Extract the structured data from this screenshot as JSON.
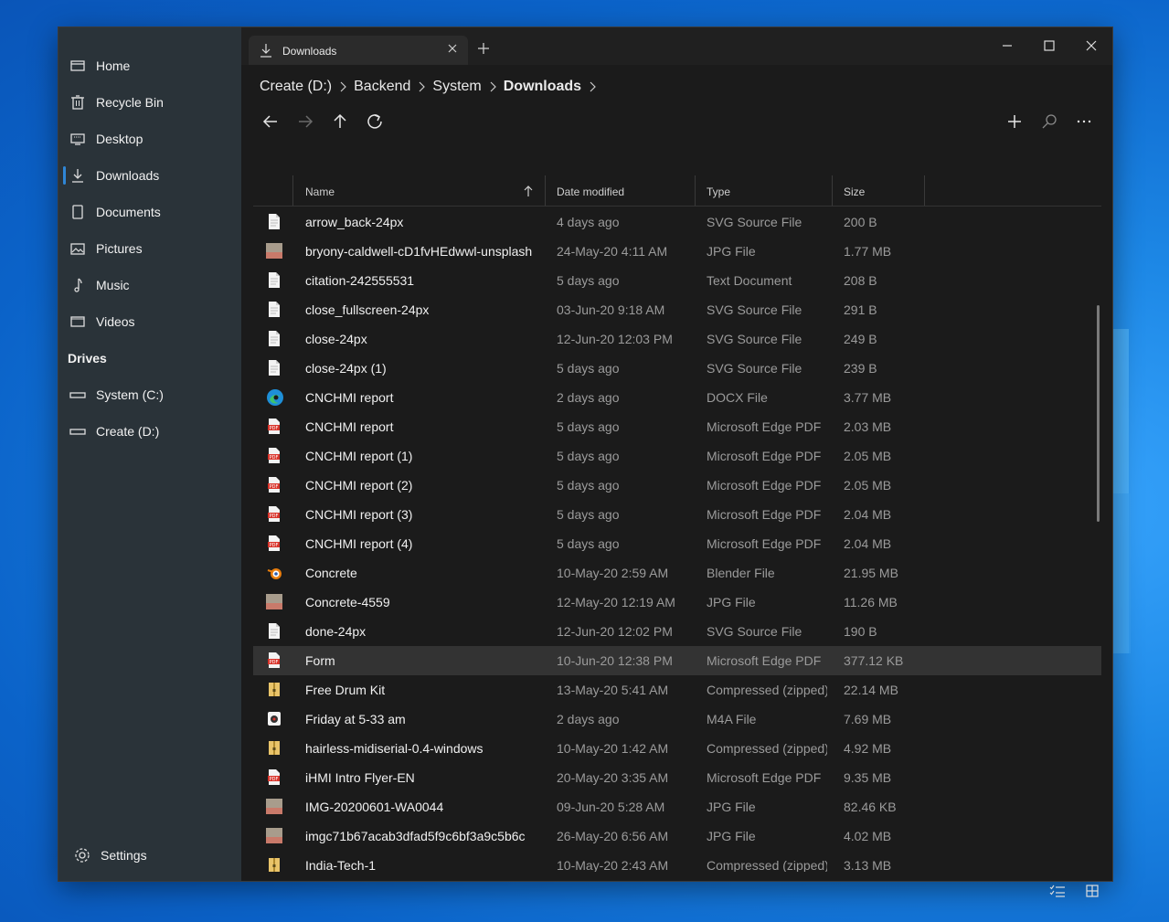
{
  "colors": {
    "accent": "#2f86d6",
    "sidebar_bg": "#2a3339",
    "content_bg": "#1b1b1b",
    "selection": "#333333",
    "pdf_red": "#d9342b",
    "zip_yellow": "#e9c46a"
  },
  "sidebar": {
    "items": [
      {
        "label": "Home",
        "icon": "home-icon"
      },
      {
        "label": "Recycle Bin",
        "icon": "recycle-bin-icon"
      },
      {
        "label": "Desktop",
        "icon": "desktop-icon"
      },
      {
        "label": "Downloads",
        "icon": "download-icon"
      },
      {
        "label": "Documents",
        "icon": "document-icon"
      },
      {
        "label": "Pictures",
        "icon": "picture-icon"
      },
      {
        "label": "Music",
        "icon": "music-icon"
      },
      {
        "label": "Videos",
        "icon": "video-icon"
      }
    ],
    "drives_header": "Drives",
    "drives": [
      {
        "label": "System (C:)",
        "icon": "drive-icon"
      },
      {
        "label": "Create (D:)",
        "icon": "drive-icon"
      }
    ],
    "settings_label": "Settings"
  },
  "tab": {
    "title": "Downloads"
  },
  "breadcrumb": {
    "parts": [
      "Create (D:)",
      "Backend",
      "System"
    ],
    "current": "Downloads"
  },
  "columns": {
    "name": "Name",
    "date": "Date modified",
    "type": "Type",
    "size": "Size"
  },
  "files": [
    {
      "name": "arrow_back-24px",
      "date": "4 days ago",
      "type": "SVG Source File",
      "size": "200 B",
      "icon": "file-icon"
    },
    {
      "name": "bryony-caldwell-cD1fvHEdwwl-unsplash",
      "date": "24-May-20 4:11 AM",
      "type": "JPG File",
      "size": "1.77 MB",
      "icon": "image-thumb-icon"
    },
    {
      "name": "citation-242555531",
      "date": "5 days ago",
      "type": "Text Document",
      "size": "208 B",
      "icon": "file-icon"
    },
    {
      "name": "close_fullscreen-24px",
      "date": "03-Jun-20 9:18 AM",
      "type": "SVG Source File",
      "size": "291 B",
      "icon": "file-icon"
    },
    {
      "name": "close-24px",
      "date": "12-Jun-20 12:03 PM",
      "type": "SVG Source File",
      "size": "249 B",
      "icon": "file-icon"
    },
    {
      "name": "close-24px (1)",
      "date": "5 days ago",
      "type": "SVG Source File",
      "size": "239 B",
      "icon": "file-icon"
    },
    {
      "name": "CNCHMI report",
      "date": "2 days ago",
      "type": "DOCX File",
      "size": "3.77 MB",
      "icon": "edge-icon"
    },
    {
      "name": "CNCHMI report",
      "date": "5 days ago",
      "type": "Microsoft Edge PDF",
      "size": "2.03 MB",
      "icon": "pdf-icon"
    },
    {
      "name": "CNCHMI report (1)",
      "date": "5 days ago",
      "type": "Microsoft Edge PDF",
      "size": "2.05 MB",
      "icon": "pdf-icon"
    },
    {
      "name": "CNCHMI report (2)",
      "date": "5 days ago",
      "type": "Microsoft Edge PDF",
      "size": "2.05 MB",
      "icon": "pdf-icon"
    },
    {
      "name": "CNCHMI report (3)",
      "date": "5 days ago",
      "type": "Microsoft Edge PDF",
      "size": "2.04 MB",
      "icon": "pdf-icon"
    },
    {
      "name": "CNCHMI report (4)",
      "date": "5 days ago",
      "type": "Microsoft Edge PDF",
      "size": "2.04 MB",
      "icon": "pdf-icon"
    },
    {
      "name": "Concrete",
      "date": "10-May-20 2:59 AM",
      "type": "Blender File",
      "size": "21.95 MB",
      "icon": "blender-icon"
    },
    {
      "name": "Concrete-4559",
      "date": "12-May-20 12:19 AM",
      "type": "JPG File",
      "size": "11.26 MB",
      "icon": "image-thumb-icon"
    },
    {
      "name": "done-24px",
      "date": "12-Jun-20 12:02 PM",
      "type": "SVG Source File",
      "size": "190 B",
      "icon": "file-icon"
    },
    {
      "name": "Form",
      "date": "10-Jun-20 12:38 PM",
      "type": "Microsoft Edge PDF",
      "size": "377.12 KB",
      "icon": "pdf-icon",
      "selected": true
    },
    {
      "name": "Free Drum Kit",
      "date": "13-May-20 5:41 AM",
      "type": "Compressed (zipped)",
      "size": "22.14 MB",
      "icon": "zip-icon"
    },
    {
      "name": "Friday at 5-33 am",
      "date": "2 days ago",
      "type": "M4A File",
      "size": "7.69 MB",
      "icon": "audio-icon"
    },
    {
      "name": "hairless-midiserial-0.4-windows",
      "date": "10-May-20 1:42 AM",
      "type": "Compressed (zipped)",
      "size": "4.92 MB",
      "icon": "zip-icon"
    },
    {
      "name": "iHMI Intro Flyer-EN",
      "date": "20-May-20 3:35 AM",
      "type": "Microsoft Edge PDF",
      "size": "9.35 MB",
      "icon": "pdf-icon"
    },
    {
      "name": "IMG-20200601-WA0044",
      "date": "09-Jun-20 5:28 AM",
      "type": "JPG File",
      "size": "82.46 KB",
      "icon": "image-thumb-icon"
    },
    {
      "name": "imgc71b67acab3dfad5f9c6bf3a9c5b6c",
      "date": "26-May-20 6:56 AM",
      "type": "JPG File",
      "size": "4.02 MB",
      "icon": "image-thumb-icon"
    },
    {
      "name": "India-Tech-1",
      "date": "10-May-20 2:43 AM",
      "type": "Compressed (zipped)",
      "size": "3.13 MB",
      "icon": "zip-icon"
    }
  ]
}
